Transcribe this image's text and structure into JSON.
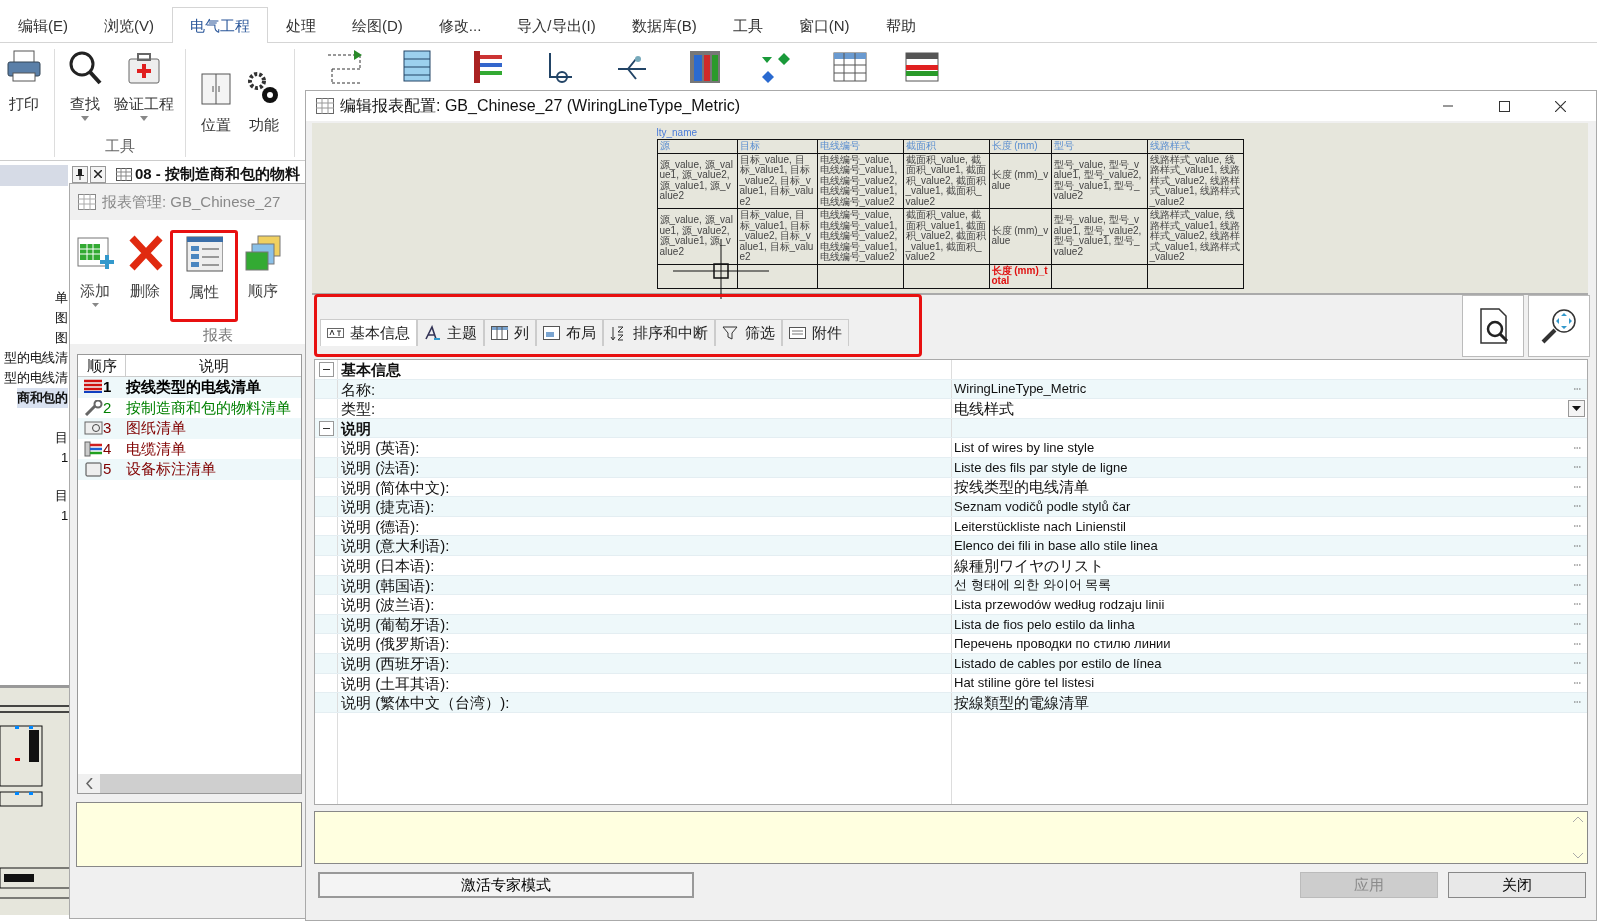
{
  "menu_tabs": [
    {
      "label": "编辑(E)",
      "selected": false
    },
    {
      "label": "浏览(V)",
      "selected": false
    },
    {
      "label": "电气工程",
      "selected": true
    },
    {
      "label": "处理",
      "selected": false
    },
    {
      "label": "绘图(D)",
      "selected": false
    },
    {
      "label": "修改...",
      "selected": false
    },
    {
      "label": "导入/导出(I)",
      "selected": false
    },
    {
      "label": "数据库(B)",
      "selected": false
    },
    {
      "label": "工具",
      "selected": false
    },
    {
      "label": "窗口(N)",
      "selected": false
    },
    {
      "label": "帮助",
      "selected": false
    }
  ],
  "ribbon": {
    "buttons": [
      {
        "label": "打印",
        "kind": "printer",
        "caret": false
      },
      {
        "label": "查找",
        "kind": "search",
        "caret": true
      },
      {
        "label": "验证工程",
        "kind": "kit",
        "caret": true
      },
      {
        "label": "位置",
        "kind": "cabinet",
        "caret": false
      },
      {
        "label": "功能",
        "kind": "gears",
        "caret": false
      }
    ],
    "group_label": "工具"
  },
  "tree_items": [
    {
      "label": "单",
      "selected": false
    },
    {
      "label": "图",
      "selected": false
    },
    {
      "label": "图",
      "selected": false
    },
    {
      "label": "型的电线清",
      "selected": false
    },
    {
      "label": "型的电线清",
      "selected": false
    },
    {
      "label": "商和包的",
      "selected": true
    },
    {
      "label": "目",
      "selected": false
    },
    {
      "label": "1",
      "selected": false
    },
    {
      "label": "目",
      "selected": false
    },
    {
      "label": "1",
      "selected": false
    }
  ],
  "document_tab": {
    "title": "08 - 按制造商和包的物料"
  },
  "report_manager": {
    "title": "报表管理: GB_Chinese_27",
    "buttons": [
      {
        "label": "添加",
        "kind": "add",
        "caret": true,
        "highlighted": false
      },
      {
        "label": "删除",
        "kind": "delete",
        "caret": false,
        "highlighted": false
      },
      {
        "label": "属性",
        "kind": "properties",
        "caret": false,
        "highlighted": true
      },
      {
        "label": "顺序",
        "kind": "order",
        "caret": false,
        "highlighted": false
      }
    ],
    "group_label": "报表",
    "columns": [
      "顺序",
      "说明"
    ],
    "rows": [
      {
        "number": "1",
        "label": "按线类型的电线清单",
        "color": "#000000",
        "bold": true,
        "kind": "wires"
      },
      {
        "number": "2",
        "label": "按制造商和包的物料清单",
        "color": "#008000",
        "bold": false,
        "kind": "wrench"
      },
      {
        "number": "3",
        "label": "图纸清单",
        "color": "#800000",
        "bold": false,
        "kind": "drawing"
      },
      {
        "number": "4",
        "label": "电缆清单",
        "color": "#800000",
        "bold": false,
        "kind": "cable"
      },
      {
        "number": "5",
        "label": "设备标注清单",
        "color": "#800000",
        "bold": false,
        "kind": "device"
      }
    ]
  },
  "dialog": {
    "title": "编辑报表配置: GB_Chinese_27 (WiringLineType_Metric)",
    "preview": {
      "field_label": "lty_name",
      "headers": [
        "源",
        "目标",
        "电线编号",
        "截面积",
        "长度 (mm)",
        "型号",
        "线路样式"
      ],
      "rows": [
        [
          "源_value, 源_value1, 源_value2, 源_value1, 源_value2",
          "目标_value, 目标_value1, 目标_value2, 目标_value1, 目标_value2",
          "电线编号_value, 电线编号_value1, 电线编号_value2, 电线编号_value1, 电线编号_value2",
          "截面积_value, 截面积_value1, 截面积_value2, 截面积_value1, 截面积_value2",
          "长度 (mm)_value",
          "型号_value, 型号_value1, 型号_value2, 型号_value1, 型号_value2",
          "线路样式_value, 线路样式_value1, 线路样式_value2, 线路样式_value1, 线路样式_value2"
        ],
        [
          "源_value, 源_value1, 源_value2, 源_value1, 源_value2",
          "目标_value, 目标_value1, 目标_value2, 目标_value1, 目标_value2",
          "电线编号_value, 电线编号_value1, 电线编号_value2, 电线编号_value1, 电线编号_value2",
          "截面积_value, 截面积_value1, 截面积_value2, 截面积_value1, 截面积_value2",
          "长度 (mm)_value",
          "型号_value, 型号_value1, 型号_value2, 型号_value1, 型号_value2",
          "线路样式_value, 线路样式_value1, 线路样式_value2, 线路样式_value1, 线路样式_value2"
        ]
      ],
      "total": "长度 (mm)_total"
    },
    "tabs_highlighted": true,
    "tabs": [
      {
        "label": "基本信息",
        "kind": "text",
        "selected": true
      },
      {
        "label": "主题",
        "kind": "theme",
        "selected": false
      },
      {
        "label": "列",
        "kind": "columns",
        "selected": false
      },
      {
        "label": "布局",
        "kind": "layout",
        "selected": false
      },
      {
        "label": "排序和中断",
        "kind": "sort",
        "selected": false
      },
      {
        "label": "筛选",
        "kind": "filter",
        "selected": false
      },
      {
        "label": "附件",
        "kind": "attach",
        "selected": false
      }
    ],
    "groups": [
      {
        "label": "基本信息",
        "expanded": true,
        "rows": [
          {
            "label": "名称:",
            "value": "WiringLineType_Metric",
            "dropdown": false
          },
          {
            "label": "类型:",
            "value": "电线样式",
            "dropdown": true
          }
        ]
      },
      {
        "label": "说明",
        "expanded": true,
        "rows": [
          {
            "label": "说明 (英语):",
            "value": "List of wires by line style",
            "dropdown": false
          },
          {
            "label": "说明 (法语):",
            "value": "Liste des fils par style de ligne",
            "dropdown": false
          },
          {
            "label": "说明 (简体中文):",
            "value": "按线类型的电线清单",
            "dropdown": false
          },
          {
            "label": "说明 (捷克语):",
            "value": "Seznam vodičů podle stylů čar",
            "dropdown": false
          },
          {
            "label": "说明 (德语):",
            "value": "Leiterstückliste nach Linienstil",
            "dropdown": false
          },
          {
            "label": "说明 (意大利语):",
            "value": "Elenco dei fili in base allo stile linea",
            "dropdown": false
          },
          {
            "label": "说明 (日本语):",
            "value": "線種別ワイヤのリスト",
            "dropdown": false
          },
          {
            "label": "说明 (韩国语):",
            "value": "선 형태에 의한 와이어 목록",
            "dropdown": false
          },
          {
            "label": "说明 (波兰语):",
            "value": "Lista przewodów według rodzaju linii",
            "dropdown": false
          },
          {
            "label": "说明 (葡萄牙语):",
            "value": "Lista de fios pelo estilo da linha",
            "dropdown": false
          },
          {
            "label": "说明 (俄罗斯语):",
            "value": "Перечень проводки по стилю линии",
            "dropdown": false
          },
          {
            "label": "说明 (西班牙语):",
            "value": "Listado de cables por estilo de línea",
            "dropdown": false
          },
          {
            "label": "说明 (土耳其语):",
            "value": "Hat stiline göre tel listesi",
            "dropdown": false
          },
          {
            "label": "说明 (繁体中文（台湾）):",
            "value": "按線類型的電線清單",
            "dropdown": false
          }
        ]
      }
    ],
    "expert_button": "激活专家模式",
    "buttons": [
      {
        "label": "应用",
        "disabled": true
      },
      {
        "label": "关闭",
        "disabled": false
      }
    ]
  }
}
